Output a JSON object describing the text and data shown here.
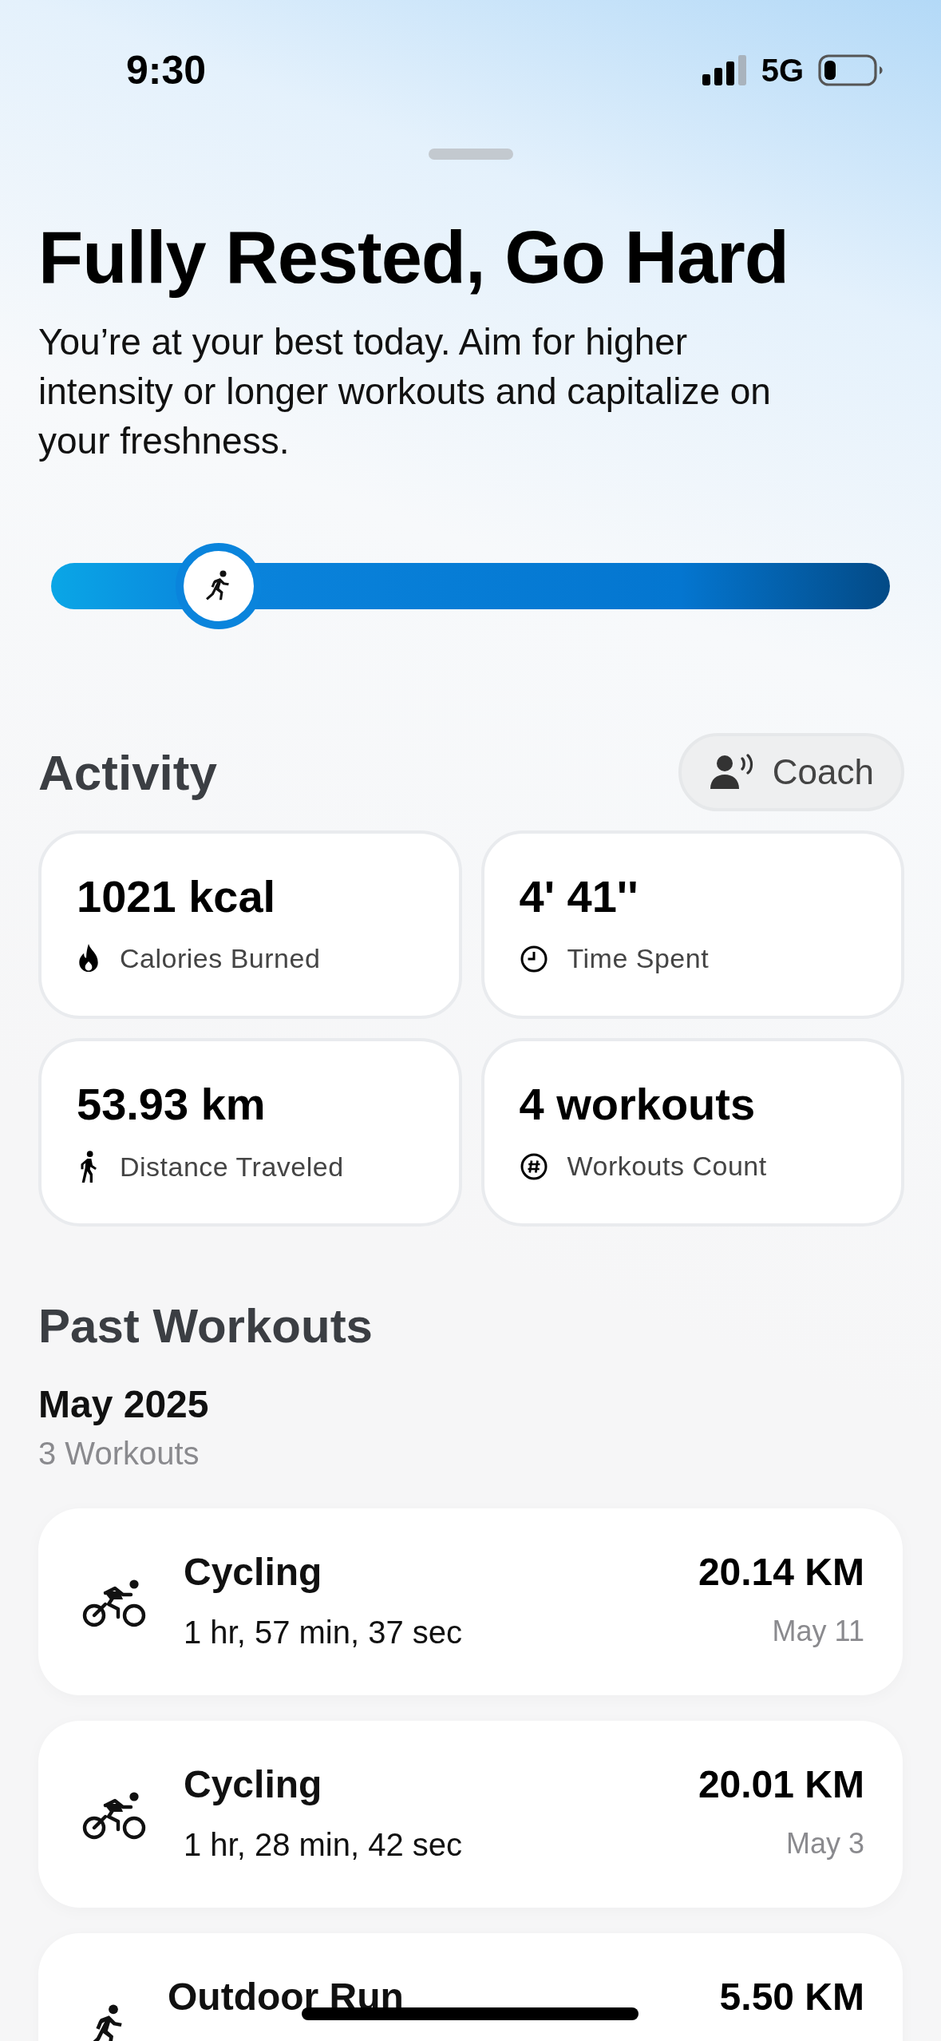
{
  "status_bar": {
    "time": "9:30",
    "network": "5G"
  },
  "header": {
    "title": "Fully Rested, Go Hard",
    "description": "You’re at your best today. Aim for higher intensity or longer workouts and capitalize on your freshness.",
    "readiness": {
      "level": 0.2
    }
  },
  "activity": {
    "title": "Activity",
    "coach_button": "Coach",
    "stats": [
      {
        "kind": "calories",
        "value": "1021 kcal",
        "label": "Calories Burned"
      },
      {
        "kind": "time",
        "value": "4' 41''",
        "label": "Time Spent"
      },
      {
        "kind": "distance",
        "value": "53.93 km",
        "label": "Distance Traveled"
      },
      {
        "kind": "count",
        "value": "4 workouts",
        "label": "Workouts Count"
      }
    ]
  },
  "past_workouts": {
    "title": "Past Workouts",
    "month": "May 2025",
    "count": "3 Workouts",
    "workouts": [
      {
        "kind": "cycling",
        "name": "Cycling",
        "duration": "1 hr, 57 min, 37 sec",
        "distance": "20.14 KM",
        "date": "May 11"
      },
      {
        "kind": "cycling",
        "name": "Cycling",
        "duration": "1 hr, 28 min, 42 sec",
        "distance": "20.01 KM",
        "date": "May 3"
      },
      {
        "kind": "run",
        "name": "Outdoor Run",
        "distance": "5.50 KM"
      }
    ]
  }
}
